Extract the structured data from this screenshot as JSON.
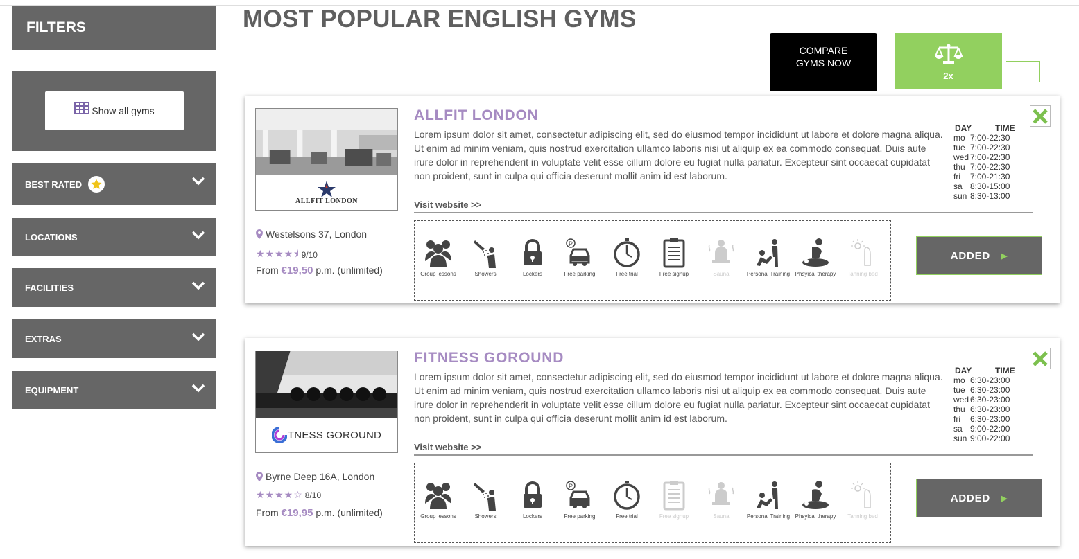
{
  "sidebar": {
    "title": "FILTERS",
    "show_all_label": "Show all gyms",
    "filters": [
      {
        "label": "BEST RATED"
      },
      {
        "label": "LOCATIONS"
      },
      {
        "label": "FACILITIES"
      },
      {
        "label": "EXTRAS"
      },
      {
        "label": "EQUIPMENT"
      }
    ]
  },
  "page_title": "MOST POPULAR ENGLISH GYMS",
  "compare": {
    "button_label": "COMPARE GYMS NOW",
    "count_label": "2x"
  },
  "colors": {
    "accent_purple": "#a68bc2",
    "accent_green": "#92d05f",
    "panel_gray": "#666666"
  },
  "gyms": [
    {
      "name": "ALLFIT LONDON",
      "logo_text": "ALLFIT LONDON",
      "description": "Lorem ipsum dolor sit amet, consectetur adipiscing elit, sed do eiusmod tempor incididunt ut labore et dolore magna aliqua. Ut enim ad minim veniam, quis nostrud exercitation ullamco laboris nisi ut aliquip ex ea commodo consequat. Duis aute irure dolor in reprehenderit in voluptate velit esse cillum dolore eu fugiat nulla pariatur. Excepteur sint occaecat cupidatat non proident, sunt in culpa qui officia deserunt mollit anim id est laborum.",
      "visit_label": "Visit website >>",
      "hours_head": {
        "day": "DAY",
        "time": "TIME"
      },
      "hours": [
        {
          "day": "mo",
          "time": "7:00-22:30"
        },
        {
          "day": "tue",
          "time": "7:00-22:30"
        },
        {
          "day": "wed",
          "time": "7:00-22:30"
        },
        {
          "day": "thu",
          "time": "7:00-22:30"
        },
        {
          "day": "fri",
          "time": "7:00-21:30"
        },
        {
          "day": "sa",
          "time": "8:30-15:00"
        },
        {
          "day": "sun",
          "time": "8:30-13:00"
        }
      ],
      "address": "Westelsons 37, London",
      "rating_stars": 4.5,
      "rating_text": "9/10",
      "price_prefix": "From",
      "price": "€19,50",
      "price_suffix": "p.m. (unlimited)",
      "facilities": [
        {
          "label": "Group lessons",
          "icon": "group-icon",
          "available": true
        },
        {
          "label": "Showers",
          "icon": "shower-icon",
          "available": true
        },
        {
          "label": "Lockers",
          "icon": "lock-icon",
          "available": true
        },
        {
          "label": "Free parking",
          "icon": "parking-icon",
          "available": true
        },
        {
          "label": "Free trial",
          "icon": "stopwatch-icon",
          "available": true
        },
        {
          "label": "Free signup",
          "icon": "clipboard-icon",
          "available": true
        },
        {
          "label": "Sauna",
          "icon": "sauna-icon",
          "available": false
        },
        {
          "label": "Personal Training",
          "icon": "trainer-icon",
          "available": true
        },
        {
          "label": "Phsyical therapy",
          "icon": "massage-icon",
          "available": true
        },
        {
          "label": "Tanning bed",
          "icon": "tanning-icon",
          "available": false
        }
      ],
      "added_label": "ADDED"
    },
    {
      "name": "FITNESS GOROUND",
      "logo_text": "TNESS GOROUND",
      "description": "Lorem ipsum dolor sit amet, consectetur adipiscing elit, sed do eiusmod tempor incididunt ut labore et dolore magna aliqua. Ut enim ad minim veniam, quis nostrud exercitation ullamco laboris nisi ut aliquip ex ea commodo consequat. Duis aute irure dolor in reprehenderit in voluptate velit esse cillum dolore eu fugiat nulla pariatur. Excepteur sint occaecat cupidatat non proident, sunt in culpa qui officia deserunt mollit anim id est laborum.",
      "visit_label": "Visit website >>",
      "hours_head": {
        "day": "DAY",
        "time": "TIME"
      },
      "hours": [
        {
          "day": "mo",
          "time": "6:30-23:00"
        },
        {
          "day": "tue",
          "time": "6:30-23:00"
        },
        {
          "day": "wed",
          "time": "6:30-23:00"
        },
        {
          "day": "thu",
          "time": "6:30-23:00"
        },
        {
          "day": "fri",
          "time": "6:30-23:00"
        },
        {
          "day": "sa",
          "time": "9:00-22:00"
        },
        {
          "day": "sun",
          "time": "9:00-22:00"
        }
      ],
      "address": "Byrne Deep 16A, London",
      "rating_stars": 4,
      "rating_text": "8/10",
      "price_prefix": "From",
      "price": "€19,95",
      "price_suffix": "p.m. (unlimited)",
      "facilities": [
        {
          "label": "Group lessons",
          "icon": "group-icon",
          "available": true
        },
        {
          "label": "Showers",
          "icon": "shower-icon",
          "available": true
        },
        {
          "label": "Lockers",
          "icon": "lock-icon",
          "available": true
        },
        {
          "label": "Free parking",
          "icon": "parking-icon",
          "available": true
        },
        {
          "label": "Free trial",
          "icon": "stopwatch-icon",
          "available": true
        },
        {
          "label": "Free signup",
          "icon": "clipboard-icon",
          "available": false
        },
        {
          "label": "Sauna",
          "icon": "sauna-icon",
          "available": false
        },
        {
          "label": "Personal Training",
          "icon": "trainer-icon",
          "available": true
        },
        {
          "label": "Phsyical therapy",
          "icon": "massage-icon",
          "available": true
        },
        {
          "label": "Tanning bed",
          "icon": "tanning-icon",
          "available": false
        }
      ],
      "added_label": "ADDED"
    }
  ]
}
